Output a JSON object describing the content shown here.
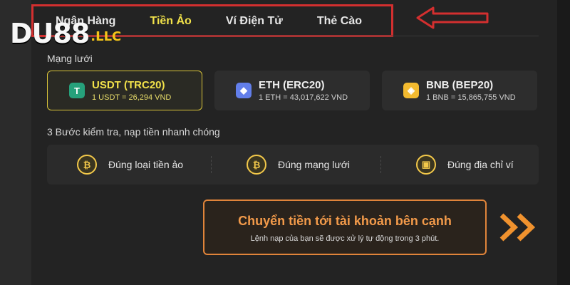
{
  "logo": {
    "main": "DU88",
    "tld": ".LLC"
  },
  "tabs": [
    {
      "label": "Ngân Hàng",
      "active": false
    },
    {
      "label": "Tiền Ảo",
      "active": true
    },
    {
      "label": "Ví Điện Tử",
      "active": false
    },
    {
      "label": "Thẻ Cào",
      "active": false
    }
  ],
  "network_section": {
    "title": "Mạng lưới"
  },
  "networks": [
    {
      "name": "USDT (TRC20)",
      "rate": "1 USDT = 26,294 VND",
      "icon": "tether-icon",
      "icon_color": "#26a17b",
      "glyph": "T",
      "selected": true
    },
    {
      "name": "ETH (ERC20)",
      "rate": "1 ETH = 43,017,622 VND",
      "icon": "ethereum-icon",
      "icon_color": "#627eea",
      "glyph": "◆",
      "selected": false
    },
    {
      "name": "BNB (BEP20)",
      "rate": "1 BNB = 15,865,755 VND",
      "icon": "bnb-icon",
      "icon_color": "#f3ba2f",
      "glyph": "◈",
      "selected": false
    }
  ],
  "steps_section": {
    "title": "3 Bước kiểm tra, nạp tiền nhanh chóng"
  },
  "steps": [
    {
      "label": "Đúng loại tiền ảo",
      "icon": "bitcoin-coin-icon"
    },
    {
      "label": "Đúng mạng lưới",
      "icon": "network-coin-icon"
    },
    {
      "label": "Đúng địa chỉ ví",
      "icon": "wallet-icon"
    }
  ],
  "cta": {
    "title": "Chuyển tiền tới tài khoản bên cạnh",
    "subtitle": "Lệnh nạp của bạn sẽ được xử lý tự động trong 3 phút."
  },
  "colors": {
    "accent": "#f2e24a",
    "cta_orange": "#e0843a",
    "annotation_red": "#d32f2f"
  }
}
